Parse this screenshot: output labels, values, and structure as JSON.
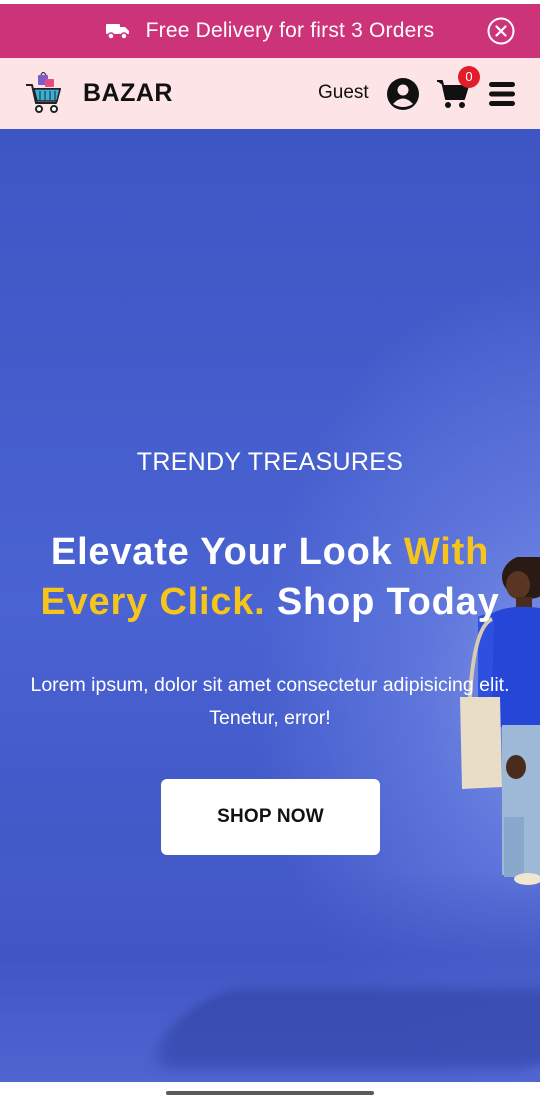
{
  "promo": {
    "text": "Free Delivery for first 3 Orders",
    "icon": "truck-icon",
    "close_icon": "close-circle-icon",
    "background": "#cc3379"
  },
  "header": {
    "brand": "BAZAR",
    "logo_icon": "shopping-cart-logo",
    "user_label": "Guest",
    "user_icon": "user-circle-icon",
    "cart_icon": "cart-icon",
    "cart_count": "0",
    "menu_icon": "hamburger-menu-icon",
    "background": "#fde4e6"
  },
  "hero": {
    "eyebrow": "TRENDY TREASURES",
    "headline_part1": "Elevate Your Look ",
    "headline_highlight": "With Every Click.",
    "headline_part2": " Shop Today",
    "description": "Lorem ipsum, dolor sit amet consectetur adipisicing elit. Tenetur, error!",
    "cta_label": "SHOP NOW",
    "highlight_color": "#f5c51c",
    "background": "#4a63d2"
  }
}
